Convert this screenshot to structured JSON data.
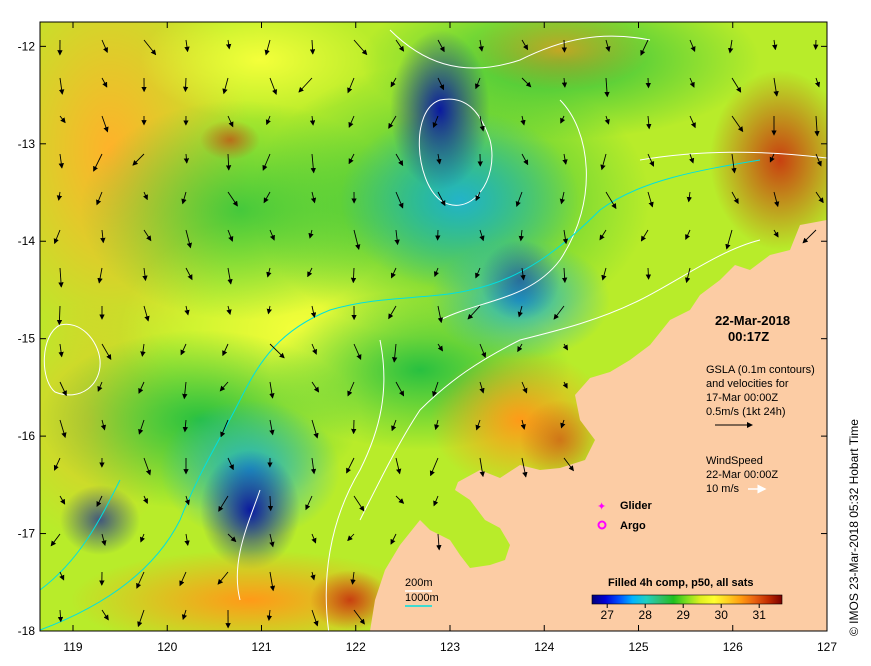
{
  "map": {
    "lon_ticks": [
      "119",
      "120",
      "121",
      "122",
      "123",
      "124",
      "125",
      "126",
      "127"
    ],
    "lat_ticks": [
      "-12",
      "-13",
      "-14",
      "-15",
      "-16",
      "-17",
      "-18"
    ],
    "lon_range": [
      118.65,
      127.0
    ],
    "lat_range": [
      -11.75,
      -18.0
    ],
    "land_color": "#fccca4"
  },
  "info": {
    "date": "22-Mar-2018",
    "time": "00:17Z",
    "gsla_line1": "GSLA (0.1m contours)",
    "gsla_line2": "and velocities for",
    "gsla_line3": "17-Mar 00:00Z",
    "velocity_scale": "0.5m/s (1kt 24h)",
    "wind_title": "WindSpeed",
    "wind_time": "22-Mar 00:00Z",
    "wind_scale": "10 m/s"
  },
  "legend": {
    "glider": "Glider",
    "argo": "Argo",
    "glider_color": "#ff00ff",
    "argo_color": "#ff00ff"
  },
  "depth_legend": {
    "d200": "200m",
    "d1000": "1000m",
    "d200_color": "#ffffff",
    "d1000_color": "#00e0e0"
  },
  "colorbar": {
    "title": "Filled 4h comp, p50, all sats",
    "ticks": [
      "27",
      "28",
      "29",
      "30",
      "31"
    ],
    "range": [
      26.6,
      31.6
    ],
    "colors": [
      "#00007a",
      "#0000d8",
      "#0050ff",
      "#00b4ff",
      "#20d0c0",
      "#30c070",
      "#20c020",
      "#80e020",
      "#e0f020",
      "#ffff30",
      "#ffd020",
      "#ff9a10",
      "#e86010",
      "#c02a00",
      "#7a0000"
    ]
  },
  "side_label": "© IMOS 23-Mar-2018 05:32 Hobart Time"
}
